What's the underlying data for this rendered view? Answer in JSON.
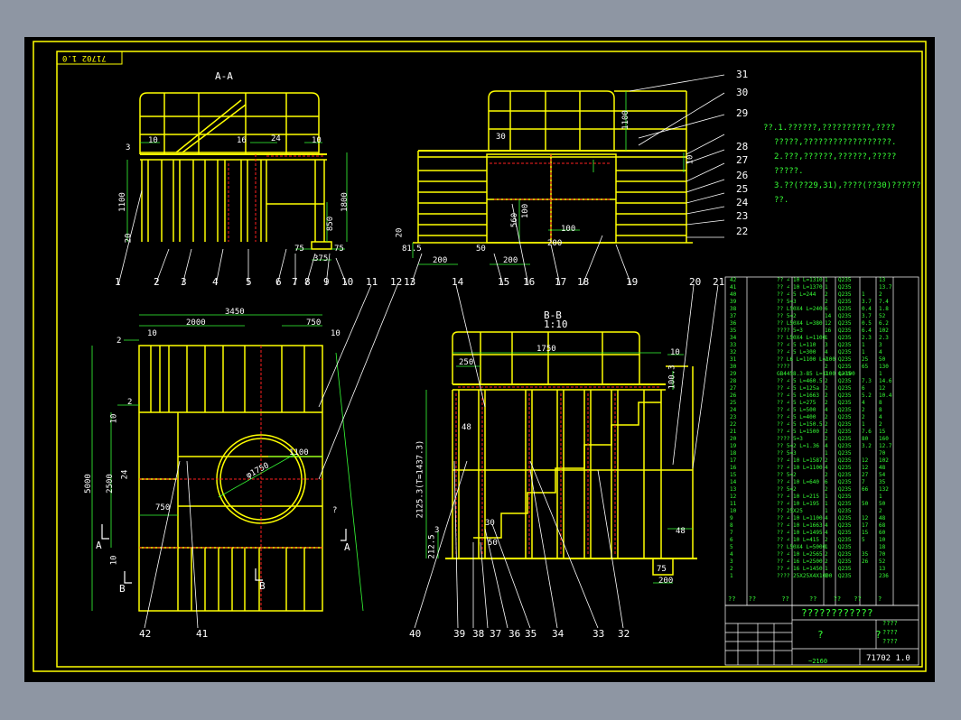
{
  "drawing_number_stamp": "71702 1.0",
  "views": {
    "section_aa": {
      "title": "A-A",
      "dims": [
        "10",
        "3",
        "16",
        "24",
        "10",
        "1100",
        "1800",
        "850",
        "20",
        "75",
        "75",
        "375"
      ]
    },
    "side_view": {
      "dims": [
        "30",
        "1100",
        "10",
        "100",
        "560",
        "200",
        "100",
        "20",
        "81.5",
        "200",
        "50",
        "200"
      ]
    },
    "plan_view": {
      "dims": [
        "3450",
        "2000",
        "750",
        "10",
        "10",
        "2",
        "10",
        "2",
        "5000",
        "2500",
        "24",
        "1100",
        "750",
        "φ1750",
        "?",
        "10",
        "A",
        "A",
        "B",
        "B"
      ]
    },
    "section_bb": {
      "title": "B-B",
      "scale": "1:10",
      "dims": [
        "1750",
        "250",
        "10",
        "100.3",
        "48",
        "2125.3(T=1437.3)",
        "30",
        "50",
        "3",
        "212.5",
        "48",
        "75",
        "200"
      ]
    }
  },
  "balloons": [
    "1",
    "2",
    "3",
    "4",
    "5",
    "6",
    "7",
    "8",
    "9",
    "10",
    "11",
    "12",
    "13",
    "14",
    "15",
    "16",
    "17",
    "18",
    "19",
    "20",
    "21",
    "22",
    "23",
    "24",
    "25",
    "26",
    "27",
    "28",
    "29",
    "30",
    "31",
    "32",
    "33",
    "34",
    "35",
    "36",
    "37",
    "38",
    "39",
    "40",
    "41",
    "42"
  ],
  "notes": [
    "??.1.??????,??????????,????",
    "?????,??????????????????.",
    "2.???,??????,??????,?????",
    "?????.",
    "3.??(??29,31),????(??30)??????",
    "??."
  ],
  "bom": {
    "rows": [
      [
        "42",
        "?? ∠ 10 L=1310",
        "1",
        "Q235",
        "",
        "13"
      ],
      [
        "41",
        "?? ∠ 10 L=1370",
        "1",
        "Q235",
        "",
        "13.7"
      ],
      [
        "40",
        "?? ∠ 5 L=244",
        "2",
        "Q235",
        "1",
        "2"
      ],
      [
        "39",
        "?? 5=3",
        "2",
        "Q235",
        "3.7",
        "7.4"
      ],
      [
        "38",
        "?? L50X4 L=240",
        "6",
        "Q235",
        "0.4",
        "1.8"
      ],
      [
        "37",
        "?? 5=2",
        "14",
        "Q235",
        "3.7",
        "52"
      ],
      [
        "36",
        "?? L50X4 L=380",
        "12",
        "Q235",
        "0.5",
        "6.2"
      ],
      [
        "35",
        "???? 5=3",
        "16",
        "Q235",
        "6.4",
        "102"
      ],
      [
        "34",
        "?? L50X4 L=1100",
        "1",
        "Q235",
        "2.3",
        "2.3"
      ],
      [
        "33",
        "?? ∠ 5 L=110",
        "3",
        "Q235",
        "1",
        "3"
      ],
      [
        "32",
        "?? ∠ 5 L=300",
        "4",
        "Q235",
        "1",
        "4"
      ],
      [
        "31",
        "?? L6 L=1100 L=100",
        "2",
        "Q235",
        "25",
        "50"
      ],
      [
        "30",
        "????",
        "2",
        "Q235",
        "65",
        "130"
      ],
      [
        "29",
        "GB4458.3-85 L=1100 L=100",
        "1",
        "Q235",
        "",
        "1"
      ],
      [
        "28",
        "?? ∠ 5 L=460.5",
        "2",
        "Q235",
        "7.3",
        "14.6"
      ],
      [
        "27",
        "?? ∠ 5 L=125a",
        "2",
        "Q235",
        "6",
        "12"
      ],
      [
        "26",
        "?? ∠ 5 L=1663",
        "2",
        "Q235",
        "5.2",
        "10.4"
      ],
      [
        "25",
        "?? ∠ 5 L=275",
        "2",
        "Q235",
        "4",
        "8"
      ],
      [
        "24",
        "?? ∠ 5 L=500",
        "4",
        "Q235",
        "2",
        "8"
      ],
      [
        "23",
        "?? ∠ 5 L=400",
        "2",
        "Q235",
        "2",
        "4"
      ],
      [
        "22",
        "?? ∠ 5 L=150.5",
        "2",
        "Q235",
        "1",
        "2"
      ],
      [
        "21",
        "?? ∠ 5 L=1500",
        "2",
        "Q235",
        "7.6",
        "15"
      ],
      [
        "20",
        "???? 5=3",
        "2",
        "Q235",
        "80",
        "160"
      ],
      [
        "19",
        "?? 5=2 L=1.36",
        "4",
        "Q235",
        "3.2",
        "12.7"
      ],
      [
        "18",
        "?? 5=3",
        "1",
        "Q235",
        "",
        "70"
      ],
      [
        "17",
        "?? ∠ 10 L=1587",
        "2",
        "Q235",
        "12",
        "102"
      ],
      [
        "16",
        "?? ∠ 10 L=1100",
        "4",
        "Q235",
        "12",
        "48"
      ],
      [
        "15",
        "?? 5=2",
        "2",
        "Q235",
        "27",
        "54"
      ],
      [
        "14",
        "?? ∠ 10 L=640",
        "6",
        "Q235",
        "7",
        "35"
      ],
      [
        "13",
        "?? 5=2",
        "2",
        "Q235",
        "66",
        "132"
      ],
      [
        "12",
        "?? ∠ 10 L=215",
        "1",
        "Q235",
        "",
        "1"
      ],
      [
        "11",
        "?? ∠ 10 L=195",
        "1",
        "Q235",
        "50",
        "50"
      ],
      [
        "10",
        "?? 25X25",
        "1",
        "Q235",
        "",
        "2"
      ],
      [
        "9",
        "?? ∠ 10 L=1100",
        "4",
        "Q235",
        "12",
        "48"
      ],
      [
        "8",
        "?? ∠ 10 L=1663",
        "4",
        "Q235",
        "17",
        "68"
      ],
      [
        "7",
        "?? ∠ 10 L=1495",
        "4",
        "Q235",
        "15",
        "60"
      ],
      [
        "6",
        "?? ∠ 10 L=415",
        "2",
        "Q235",
        "5",
        "10"
      ],
      [
        "5",
        "?? L50X4 L=5000",
        "1",
        "Q235",
        "",
        "18"
      ],
      [
        "4",
        "?? ∠ 10 L=2565",
        "2",
        "Q235",
        "35",
        "70"
      ],
      [
        "3",
        "?? ∠ 16 L=2500",
        "2",
        "Q235",
        "26",
        "52"
      ],
      [
        "2",
        "?? ∠ 16 L=1450",
        "1",
        "Q235",
        "",
        "13"
      ],
      [
        "1",
        "???? 25X25X4X1000",
        "1",
        "Q235",
        "",
        "236"
      ]
    ],
    "header": [
      "??",
      "??",
      "??",
      "??",
      "??",
      "??",
      "?"
    ]
  },
  "title_block": {
    "name": "????????????",
    "left_mark": "?",
    "right_mark": "?",
    "number": "71702 1.0",
    "qty": "~2160",
    "codes": [
      "????",
      "????",
      "????",
      "?",
      "?",
      "?"
    ]
  },
  "colors": {
    "frame": "#ffff00",
    "structure": "#ffff00",
    "hidden": "#ff2020",
    "dimension": "#36ff36",
    "leader": "#ffffff"
  }
}
